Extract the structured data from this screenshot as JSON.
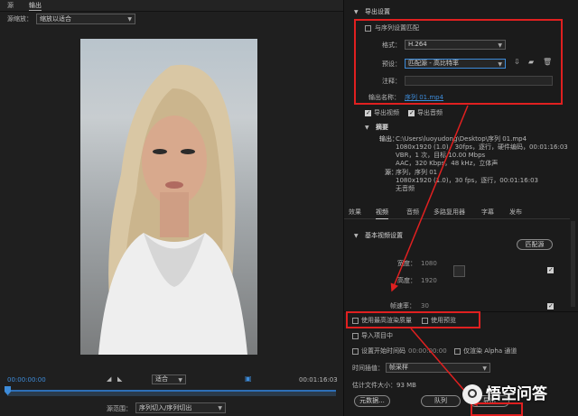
{
  "tabs": {
    "source": "源",
    "output": "输出"
  },
  "source_scaling": {
    "label": "源缩放：",
    "value": "缩放以适合"
  },
  "preview": {
    "timecode_start": "00:00:00:00",
    "timecode_end": "00:01:16:03",
    "fit_value": "适合",
    "source_range_label": "源范围：",
    "source_range_value": "序列切入/序列切出"
  },
  "export_settings": {
    "section_title": "导出设置",
    "match_sequence_label": "与序列设置匹配",
    "format_label": "格式：",
    "format_value": "H.264",
    "preset_label": "预设：",
    "preset_value": "匹配源 - 高比特率",
    "comment_label": "注释：",
    "output_name_label": "输出名称：",
    "output_name_value": "序列 01.mp4",
    "export_video_label": "导出视频",
    "export_audio_label": "导出音频"
  },
  "summary": {
    "title": "摘要",
    "output_label": "输出：",
    "output_lines": [
      "C:\\Users\\luoyudong\\Desktop\\序列 01.mp4",
      "1080x1920 (1.0)，30fps，逐行，硬件编码，00:01:16:03",
      "VBR，1 次，目标 10.00 Mbps",
      "AAC，320 Kbps，48 kHz，立体声"
    ],
    "source_label": "源：",
    "source_lines": [
      "序列，序列 01",
      "1080x1920 (1.0)，30 fps，逐行，00:01:16:03",
      "无音频"
    ]
  },
  "settings_tabs": [
    "效果",
    "视频",
    "音频",
    "多路复用器",
    "字幕",
    "发布"
  ],
  "basic_video": {
    "title": "基本视频设置",
    "match_source_button": "匹配源",
    "width_label": "宽度：",
    "width_value": "1080",
    "height_label": "高度：",
    "height_value": "1920",
    "frame_rate_label": "帧速率：",
    "frame_rate_value": "30"
  },
  "bottom": {
    "max_render_quality": "使用最高渲染质量",
    "use_previews": "使用预览",
    "import_into_project": "导入项目中",
    "set_start_timecode": "设置开始时间码",
    "start_timecode_value": "00:00:00:00",
    "render_alpha_only": "仅渲染 Alpha 通道",
    "time_interpolation_label": "时间插值：",
    "time_interpolation_value": "帧采样",
    "estimated_size": "估计文件大小：93 MB",
    "metadata_button": "元数据...",
    "queue_button": "队列",
    "export_button": "导出"
  },
  "watermark": "悟空问答",
  "colors": {
    "accent_blue": "#3d8bd9",
    "annotation_red": "#e02020",
    "background": "#1d1d1d"
  }
}
